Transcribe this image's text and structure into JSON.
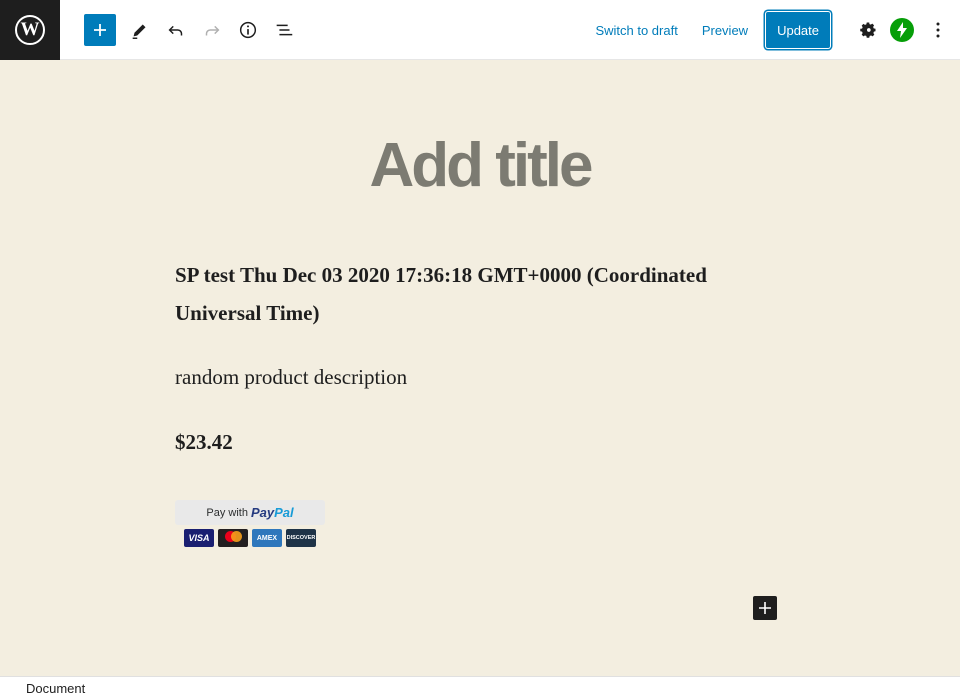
{
  "toolbar": {
    "switch_to_draft": "Switch to draft",
    "preview": "Preview",
    "update": "Update"
  },
  "icons": {
    "logo": "wordpress-logo",
    "add": "plus-icon",
    "tools": "pencil-icon",
    "undo": "undo-icon",
    "redo": "redo-icon",
    "info": "info-icon",
    "outline": "list-view-icon",
    "settings": "gear-icon",
    "jetpack": "jetpack-icon",
    "more": "more-vertical-icon"
  },
  "colors": {
    "accent": "#007cba",
    "background": "#f3eee0",
    "jetpack": "#069e08"
  },
  "editor": {
    "title_placeholder": "Add title",
    "heading": "SP test Thu Dec 03 2020 17:36:18 GMT+0000 (Coordinated Universal Time)",
    "description": "random product description",
    "price": "$23.42"
  },
  "paypal": {
    "pay_with": "Pay with",
    "brand_pay": "Pay",
    "brand_pal": "Pal",
    "cards": [
      "VISA",
      "mastercard",
      "AMEX",
      "DISCOVER"
    ]
  },
  "footer": {
    "breadcrumb": "Document"
  }
}
